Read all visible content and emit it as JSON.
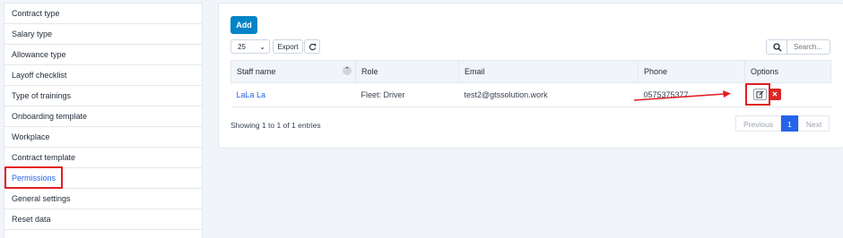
{
  "sidebar": {
    "items": [
      {
        "label": "Contract type"
      },
      {
        "label": "Salary type"
      },
      {
        "label": "Allowance type"
      },
      {
        "label": "Layoff checklist"
      },
      {
        "label": "Type of trainings"
      },
      {
        "label": "Onboarding template"
      },
      {
        "label": "Workplace"
      },
      {
        "label": "Contract template"
      },
      {
        "label": "Permissions"
      },
      {
        "label": "General settings"
      },
      {
        "label": "Reset data"
      }
    ]
  },
  "toolbar": {
    "add_label": "Add",
    "length_value": "25",
    "export_label": "Export",
    "search_placeholder": "Search..."
  },
  "table": {
    "headers": [
      "Staff name",
      "Role",
      "Email",
      "Phone",
      "Options"
    ],
    "rows": [
      {
        "staff_name": "LaLa La",
        "role": "Fleet: Driver",
        "email": "test2@gtssolution.work",
        "phone": "0575375377"
      }
    ]
  },
  "footer": {
    "info": "Showing 1 to 1 of 1 entries",
    "prev_label": "Previous",
    "page": "1",
    "next_label": "Next"
  },
  "colors": {
    "accent": "#2563eb",
    "add_button": "#0284c7",
    "delete_button": "#dc2626",
    "highlight": "#e11d24"
  },
  "icons": {
    "reload": "reload-icon",
    "search": "search-icon",
    "sort": "sort-icon",
    "edit": "edit-icon",
    "delete": "close-icon"
  }
}
